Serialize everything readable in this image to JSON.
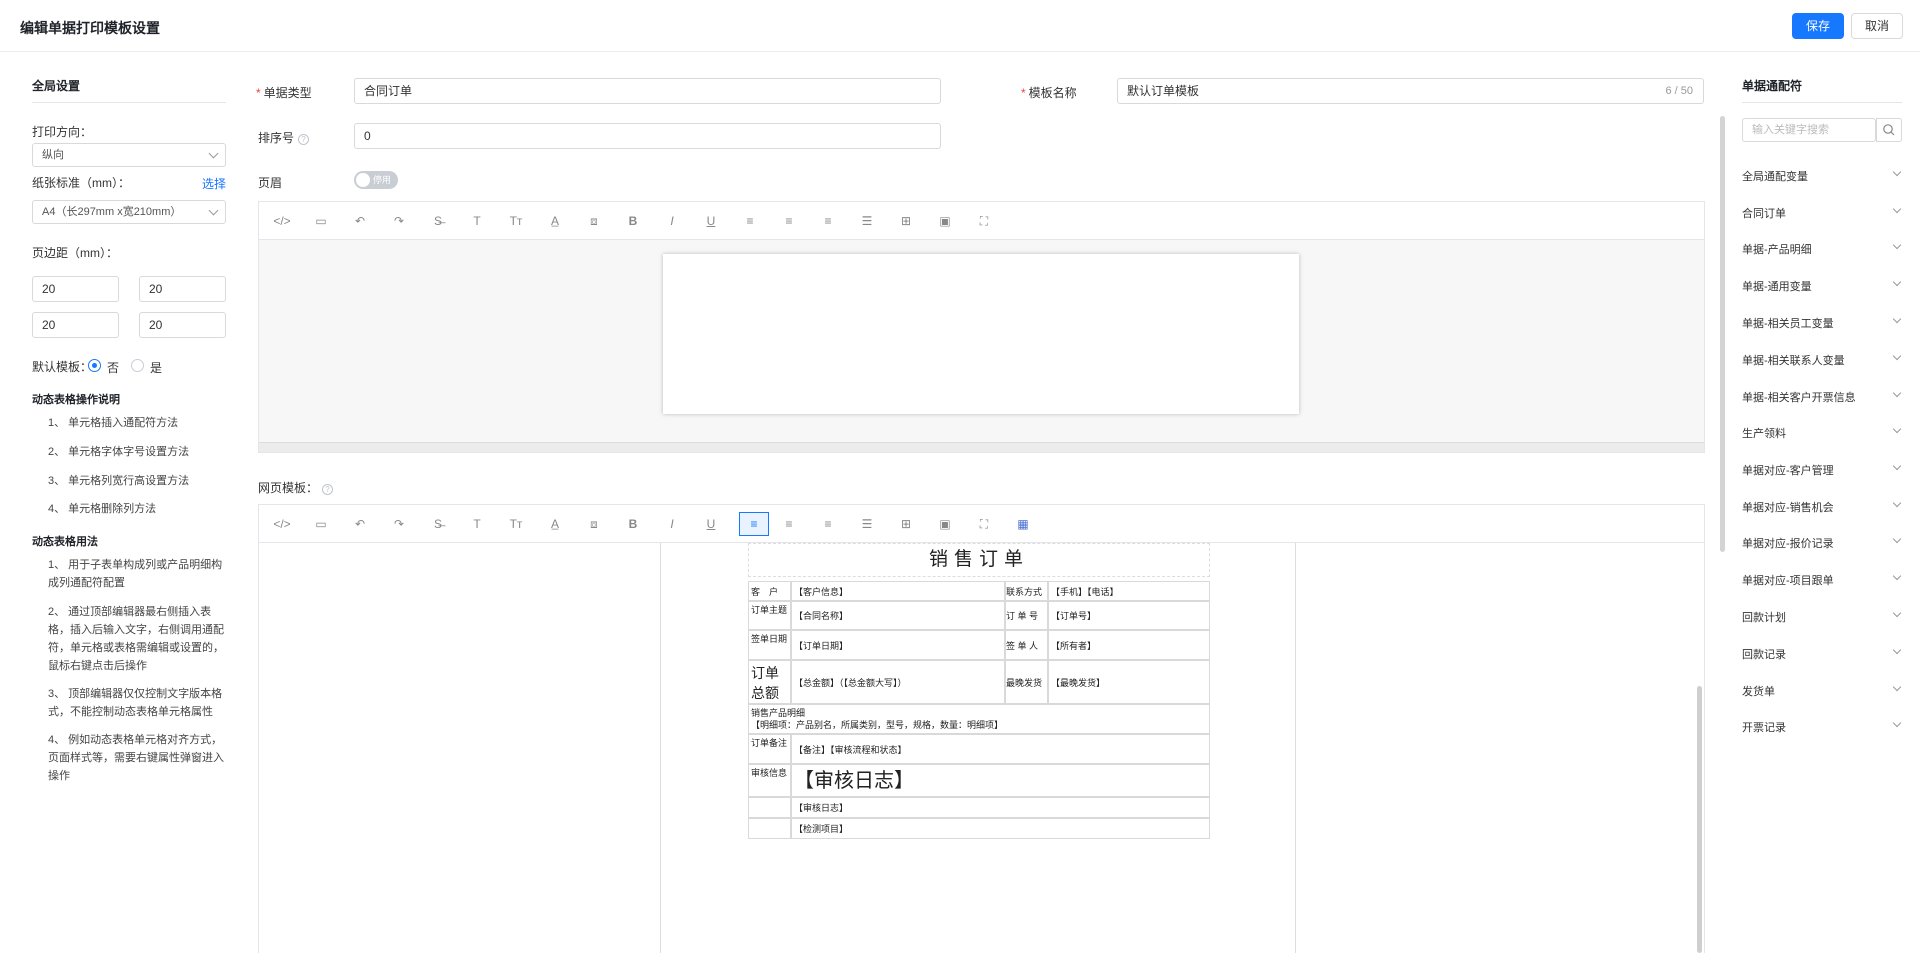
{
  "header": {
    "title": "编辑单据打印模板设置",
    "save": "保存",
    "cancel": "取消"
  },
  "left": {
    "global_title": "全局设置",
    "orientation_label": "打印方向：",
    "orientation_value": "纵向",
    "paper_label": "纸张标准（mm）：",
    "paper_link": "选择",
    "paper_value": "A4（长297mm x宽210mm）",
    "margin_label": "页边距（mm）：",
    "margins": [
      "20",
      "20",
      "20",
      "20"
    ],
    "default_label": "默认模板：",
    "default_no": "否",
    "default_yes": "是",
    "dyn_ops_title": "动态表格操作说明",
    "dyn_ops": [
      "1、 单元格插入通配符方法",
      "2、 单元格字体字号设置方法",
      "3、 单元格列宽行高设置方法",
      "4、 单元格删除列方法"
    ],
    "dyn_usage_title": "动态表格用法",
    "dyn_usage": [
      "1、 用于子表单构成列或产品明细构成列通配符配置",
      "2、 通过顶部编辑器最右侧插入表格，插入后输入文字，右侧调用通配符，单元格或表格需编辑或设置的，鼠标右键点击后操作",
      "3、 顶部编辑器仅仅控制文字版本格式，不能控制动态表格单元格属性",
      "4、 例如动态表格单元格对齐方式，页面样式等，需要右键属性弹窗进入操作"
    ]
  },
  "form": {
    "doc_type_label": "单据类型",
    "doc_type_value": "合同订单",
    "template_name_label": "模板名称",
    "template_name_value": "默认订单模板",
    "template_name_counter": "6 / 50",
    "sort_label": "排序号",
    "sort_value": "0",
    "header_label": "页眉",
    "header_toggle": "停用",
    "web_template_label": "网页模板："
  },
  "toolbar_icons": [
    "code-icon",
    "template-icon",
    "undo-icon",
    "redo-icon",
    "strikethrough-icon",
    "font-size-icon",
    "text-format-icon",
    "font-color-icon",
    "bg-color-icon",
    "bold-icon",
    "italic-icon",
    "underline-icon",
    "align-left-icon",
    "align-center-icon",
    "align-right-icon",
    "align-justify-icon",
    "table-icon",
    "image-icon",
    "fullscreen-icon",
    "dynamic-table-icon"
  ],
  "document": {
    "title": "销售订单",
    "rows": {
      "customer_label": "客　户",
      "customer_value": "【客户信息】",
      "contact_label": "联系方式",
      "contact_value": "【手机】【电话】",
      "subject_label": "订单主题",
      "subject_value": "【合同名称】",
      "order_no_label": "订 单 号",
      "order_no_value": "【订单号】",
      "sign_date_label": "签单日期",
      "sign_date_value": "【订单日期】",
      "signer_label": "签 单 人",
      "signer_value": "【所有者】",
      "total_label": "订单总额",
      "total_value": "【总金额】（【总金额大写】）",
      "latest_ship_label": "最晚发货",
      "latest_ship_value": "【最晚发货】",
      "products_title": "销售产品明细",
      "products_value": "【明细项：产品别名，所属类别，型号，规格，数量：明细项】",
      "remark_label": "订单备注",
      "remark_value": "【备注】【审核流程和状态】",
      "audit_label": "审核信息",
      "audit_log_big": "【审核日志】",
      "audit_log_small": "【审核日志】",
      "check_items": "【检测项目】"
    }
  },
  "right": {
    "title": "单据通配符",
    "search_placeholder": "输入关键字搜索",
    "items": [
      "全局通配变量",
      "合同订单",
      "单据-产品明细",
      "单据-通用变量",
      "单据-相关员工变量",
      "单据-相关联系人变量",
      "单据-相关客户开票信息",
      "生产领料",
      "单据对应-客户管理",
      "单据对应-销售机会",
      "单据对应-报价记录",
      "单据对应-项目跟单",
      "回款计划",
      "回款记录",
      "发货单",
      "开票记录"
    ]
  },
  "colors": {
    "primary": "#1677ff",
    "required": "#f53f3f"
  }
}
